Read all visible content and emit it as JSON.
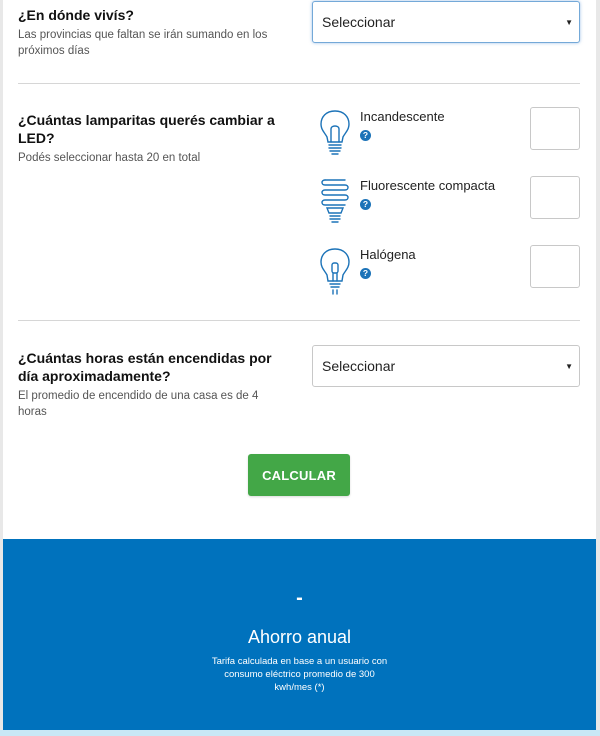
{
  "location": {
    "title": "¿En dónde vivís?",
    "help": "Las provincias que faltan se irán sumando en los próximos días",
    "select_value": "Seleccionar"
  },
  "lamps": {
    "title": "¿Cuántas lamparitas querés cambiar a LED?",
    "help": "Podés seleccionar hasta 20 en total",
    "items": [
      {
        "label": "Incandescente",
        "icon": "incandescent-bulb-icon"
      },
      {
        "label": "Fluorescente compacta",
        "icon": "cfl-bulb-icon"
      },
      {
        "label": "Halógena",
        "icon": "halogen-bulb-icon"
      }
    ]
  },
  "hours": {
    "title": "¿Cuántas horas están encendidas por día aproximadamente?",
    "help": "El promedio de encendido de una casa es de 4 horas",
    "select_value": "Seleccionar"
  },
  "calculate_label": "CALCULAR",
  "result": {
    "value": "-",
    "title": "Ahorro anual",
    "note": "Tarifa calculada en base a un usuario con consumo eléctrico promedio de 300 kwh/mes (*)"
  },
  "colors": {
    "accent_blue": "#0072bd",
    "button_green": "#43a747",
    "help_icon_blue": "#1c73b8"
  }
}
